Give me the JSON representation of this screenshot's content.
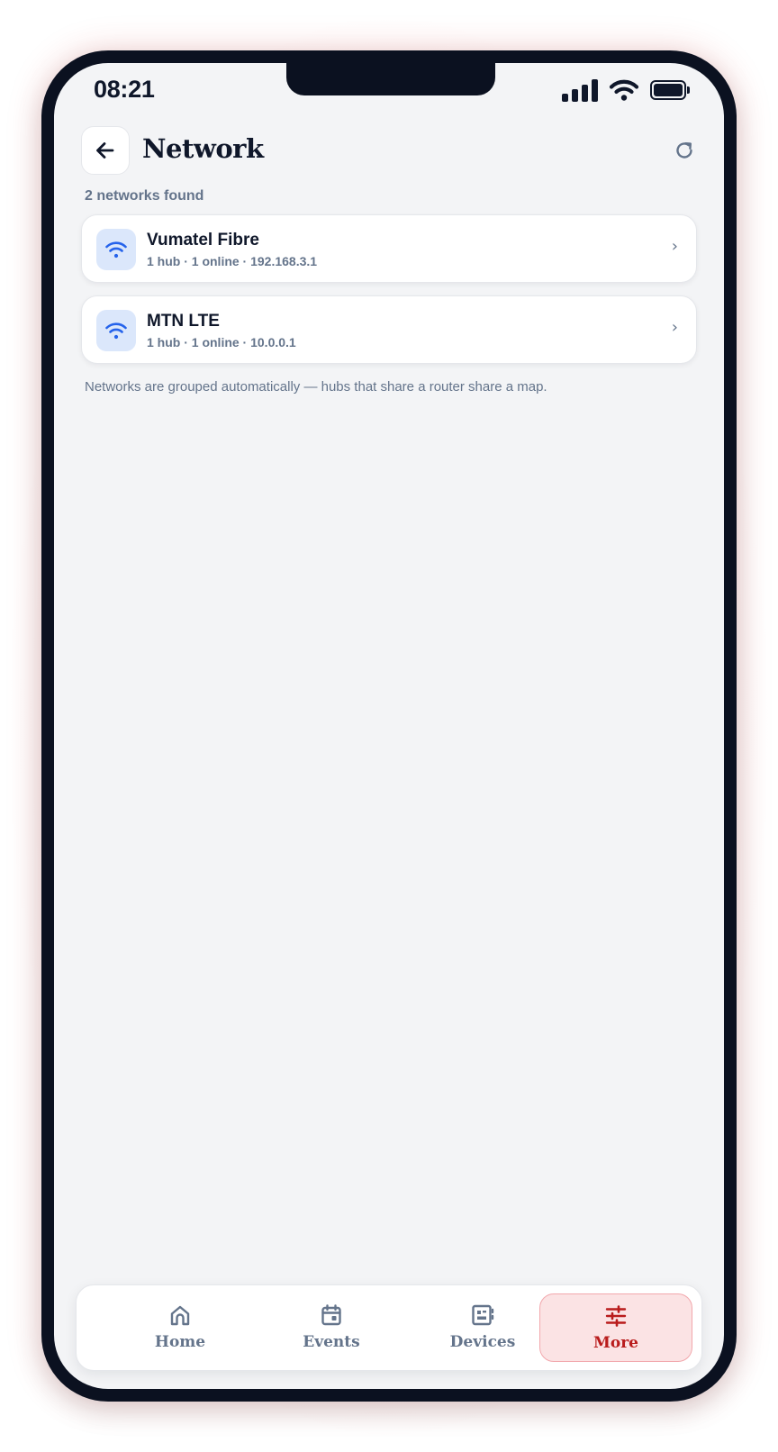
{
  "status_bar": {
    "time": "08:21"
  },
  "header": {
    "title": "Network"
  },
  "summary": {
    "found_text": "2 networks found"
  },
  "networks": [
    {
      "name": "Vumatel Fibre",
      "meta": "1 hub · 1 online · 192.168.3.1",
      "chevron": "›"
    },
    {
      "name": "MTN LTE",
      "meta": "1 hub · 1 online · 10.0.0.1",
      "chevron": "›"
    }
  ],
  "footnote": "Networks are grouped automatically — hubs that share a router share a map.",
  "tabbar": {
    "tabs": [
      {
        "label": "Home",
        "icon": "home-icon"
      },
      {
        "label": "Events",
        "icon": "calendar-icon"
      },
      {
        "label": "Devices",
        "icon": "devices-icon"
      },
      {
        "label": "More",
        "icon": "sliders-icon"
      }
    ],
    "active_tab": "More"
  },
  "colors": {
    "accent": "#b91c1c",
    "accent_bg": "#fbe3e4",
    "wifi_blue": "#2563eb",
    "text_primary": "#0f172a",
    "text_muted": "#64748b",
    "screen_bg": "#f3f4f6"
  }
}
